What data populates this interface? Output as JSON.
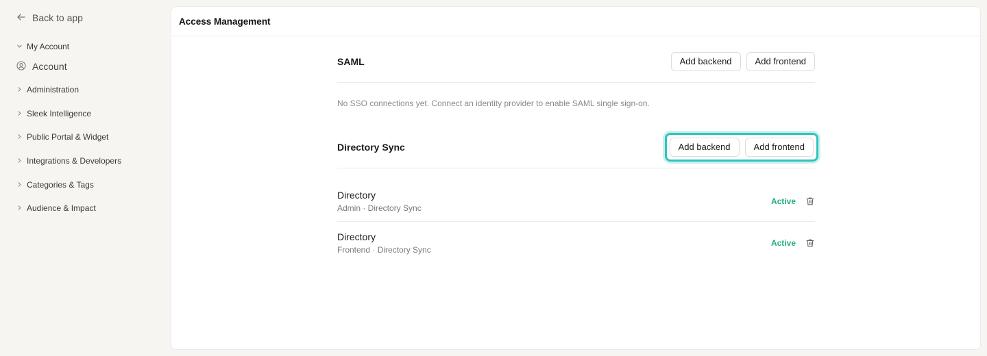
{
  "sidebar": {
    "back_label": "Back to app",
    "my_account_label": "My Account",
    "account_label": "Account",
    "groups": [
      {
        "label": "Administration"
      },
      {
        "label": "Sleek Intelligence"
      },
      {
        "label": "Public Portal & Widget"
      },
      {
        "label": "Integrations & Developers"
      },
      {
        "label": "Categories & Tags"
      },
      {
        "label": "Audience & Impact"
      }
    ]
  },
  "page": {
    "title": "Access Management"
  },
  "saml": {
    "title": "SAML",
    "add_backend": "Add backend",
    "add_frontend": "Add frontend",
    "empty_message": "No SSO connections yet. Connect an identity provider to enable SAML single sign-on."
  },
  "directory_sync": {
    "title": "Directory Sync",
    "add_backend": "Add backend",
    "add_frontend": "Add frontend",
    "items": [
      {
        "name": "Directory",
        "meta": "Admin · Directory Sync",
        "status": "Active"
      },
      {
        "name": "Directory",
        "meta": "Frontend · Directory Sync",
        "status": "Active"
      }
    ]
  },
  "colors": {
    "accent": "#2ec4bd",
    "status_active": "#22b07d",
    "sidebar_bg": "#f6f5f2"
  },
  "icons": {
    "back": "arrow-left-icon",
    "expand": "chevron-down-icon",
    "collapsed": "chevron-right-icon",
    "account": "user-circle-icon",
    "delete": "trash-icon"
  }
}
